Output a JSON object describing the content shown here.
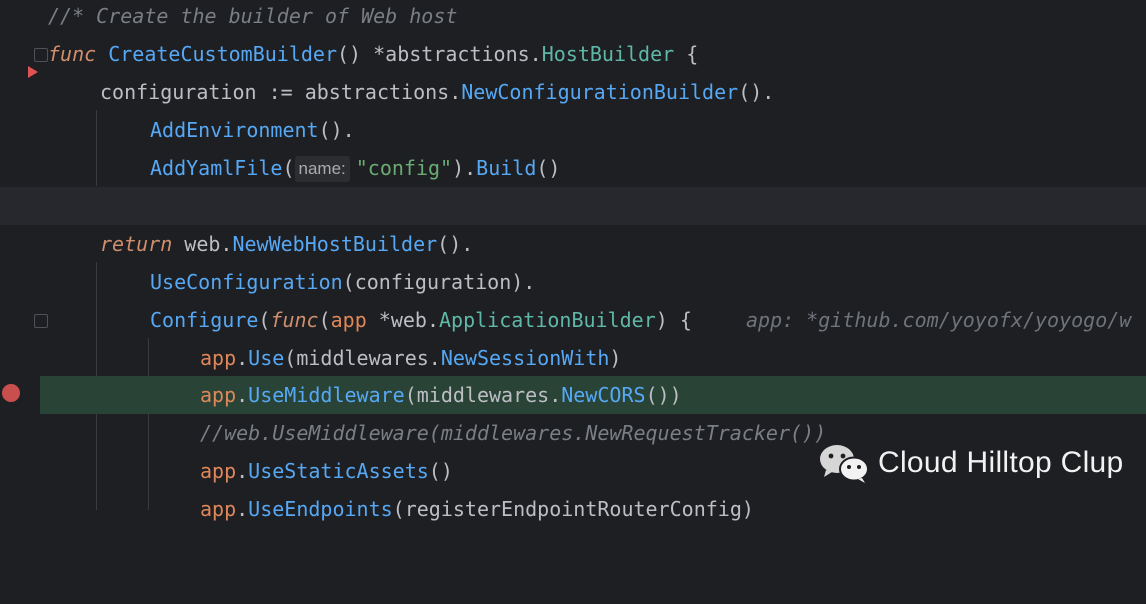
{
  "editor": {
    "lines": {
      "l0": {
        "comment": "//* Create the builder of Web host"
      },
      "l1": {
        "kw": "func",
        "name": "CreateCustomBuilder",
        "paren": "() *abstractions.",
        "type": "HostBuilder",
        "brace": " {"
      },
      "l2": {
        "lhs": "configuration := abstractions.",
        "call": "NewConfigurationBuilder",
        "tail": "()."
      },
      "l3": {
        "call": "AddEnvironment",
        "tail": "()."
      },
      "l4": {
        "call": "AddYamlFile",
        "open": "(",
        "hint": "name:",
        "str": "\"config\"",
        "mid": ").",
        "call2": "Build",
        "tail": "()"
      },
      "l6": {
        "kw": "return",
        "mid": " web.",
        "call": "NewWebHostBuilder",
        "tail": "()."
      },
      "l7": {
        "call": "UseConfiguration",
        "tail": "(configuration)."
      },
      "l8": {
        "call": "Configure",
        "open": "(",
        "kw": "func",
        "p1": "(",
        "param": "app",
        "p2": " *web.",
        "type": "ApplicationBuilder",
        "p3": ") {",
        "hint": "app: *github.com/yoyofx/yoyogo/w"
      },
      "l9": {
        "recv": "app",
        "dot": ".",
        "call": "Use",
        "open": "(middlewares.",
        "call2": "NewSessionWith",
        "tail": ")"
      },
      "l10": {
        "recv": "app",
        "dot": ".",
        "call": "UseMiddleware",
        "open": "(middlewares.",
        "call2": "NewCORS",
        "tail": "())"
      },
      "l11": {
        "comment": "//web.UseMiddleware(middlewares.NewRequestTracker())"
      },
      "l12": {
        "recv": "app",
        "dot": ".",
        "call": "UseStaticAssets",
        "tail": "()"
      },
      "l13": {
        "recv": "app",
        "dot": ".",
        "call": "UseEndpoints",
        "tail": "(registerEndpointRouterConfig)"
      }
    }
  },
  "watermark": {
    "text": "Cloud Hilltop Clup",
    "icon": "wechat-icon"
  },
  "gutter": {
    "breakpoint_icon": "breakpoint-icon",
    "run_icon": "run-marker-icon"
  },
  "colors": {
    "background": "#1e1f22",
    "keyword": "#cf8e6d",
    "function": "#56a8f5",
    "type": "#5fb8a7",
    "string": "#6aab73",
    "comment": "#7a7e85",
    "breakpoint_line": "#294436",
    "breakpoint": "#c94f4f"
  }
}
